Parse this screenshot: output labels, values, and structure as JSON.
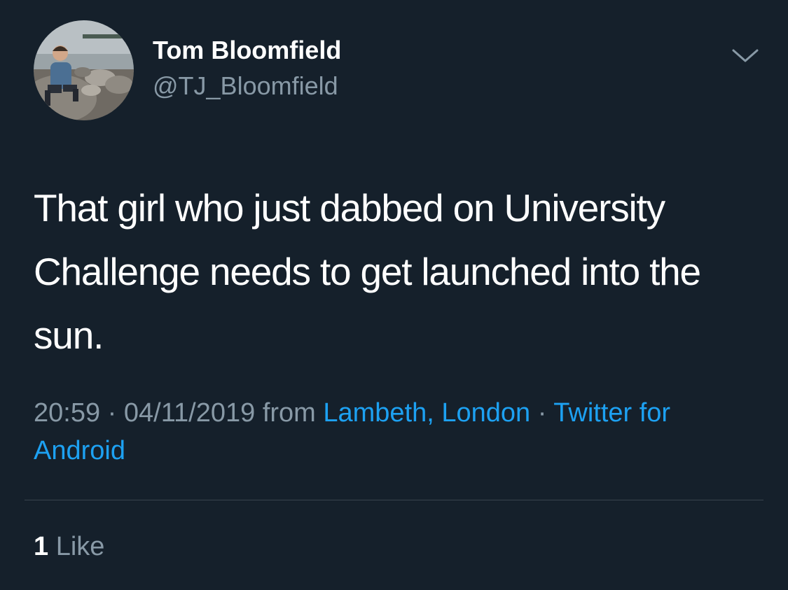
{
  "theme": {
    "background": "#15202b",
    "primary_text": "#ffffff",
    "secondary_text": "#8899a6",
    "link": "#1da1f2",
    "divider": "#38444d"
  },
  "author": {
    "display_name": "Tom Bloomfield",
    "handle": "@TJ_Bloomfield",
    "avatar_icon": "profile-photo"
  },
  "tweet": {
    "text": "That girl who just dabbed on University Challenge needs to get launched into the sun.",
    "time": "20:59",
    "date": "04/11/2019",
    "from_label": "from",
    "location": "Lambeth, London",
    "separator": "·",
    "source": "Twitter for Android"
  },
  "menu": {
    "icon": "chevron-down-icon"
  },
  "stats": {
    "likes_count": "1",
    "likes_label": "Like"
  }
}
